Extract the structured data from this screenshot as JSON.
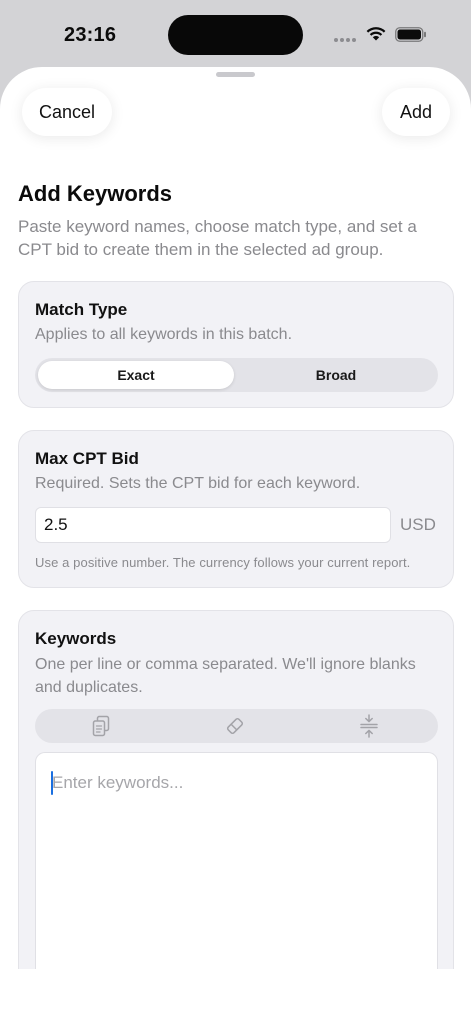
{
  "status_bar": {
    "time": "23:16"
  },
  "nav": {
    "cancel_label": "Cancel",
    "add_label": "Add"
  },
  "header": {
    "title": "Add Keywords",
    "subtitle": "Paste keyword names, choose match type, and set a CPT bid to create them in the selected ad group."
  },
  "match_type": {
    "title": "Match Type",
    "description": "Applies to all keywords in this batch.",
    "options": [
      "Exact",
      "Broad"
    ],
    "selected": "Exact"
  },
  "max_cpt_bid": {
    "title": "Max CPT Bid",
    "description": "Required. Sets the CPT bid for each keyword.",
    "value": "2.5",
    "currency": "USD",
    "hint": "Use a positive number. The currency follows your current report."
  },
  "keywords": {
    "title": "Keywords",
    "description": "One per line or comma separated. We'll ignore blanks and duplicates.",
    "placeholder": "Enter keywords...",
    "toolbar_icons": [
      "paste-icon",
      "eraser-icon",
      "dedupe-icon"
    ]
  },
  "colors": {
    "accent_caret": "#1a6fe0",
    "card_bg": "#f2f2f6",
    "secondary_text": "#8a8a8e"
  }
}
